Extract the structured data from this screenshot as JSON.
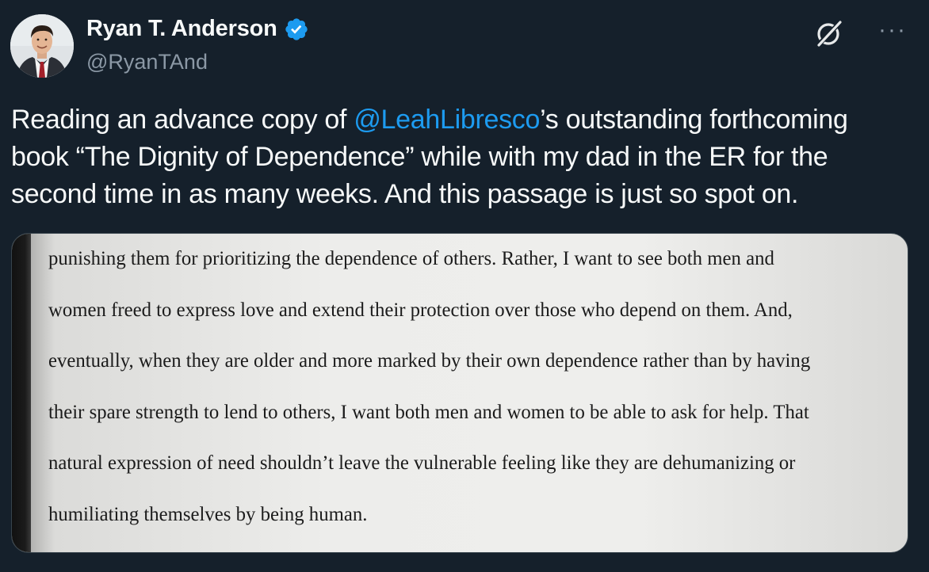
{
  "tweet": {
    "author": {
      "display_name": "Ryan T. Anderson",
      "handle": "@RyanTAnd",
      "verified_icon": "verified-badge-icon"
    },
    "actions": {
      "grok_icon": "grok-icon",
      "more_icon": "more-options-icon",
      "more_glyph": "···"
    },
    "text": {
      "before_mention": "Reading an advance copy of ",
      "mention": "@LeahLibresco",
      "after_mention": "’s outstanding forthcoming book “The Dignity of Dependence” while with my dad in the ER for the second time in as many weeks. And this passage is just so spot on."
    },
    "media": {
      "page_lines": [
        "punishing them for prioritizing the dependence of others. Rather, I want to see both men and",
        "women freed to express love and extend their protection over those who depend on them. And,",
        "eventually, when they are older and more marked by their own dependence rather than by having",
        "their spare strength to lend to others, I want both men and women to be able to ask for help. That",
        "natural expression of need shouldn’t leave the vulnerable feeling like they are dehumanizing or",
        "humiliating themselves by being human."
      ]
    }
  },
  "colors": {
    "background": "#15202b",
    "text_primary": "#f7f9f9",
    "text_secondary": "#8b98a5",
    "link": "#1d9bf0",
    "verified": "#1d9bf0"
  }
}
